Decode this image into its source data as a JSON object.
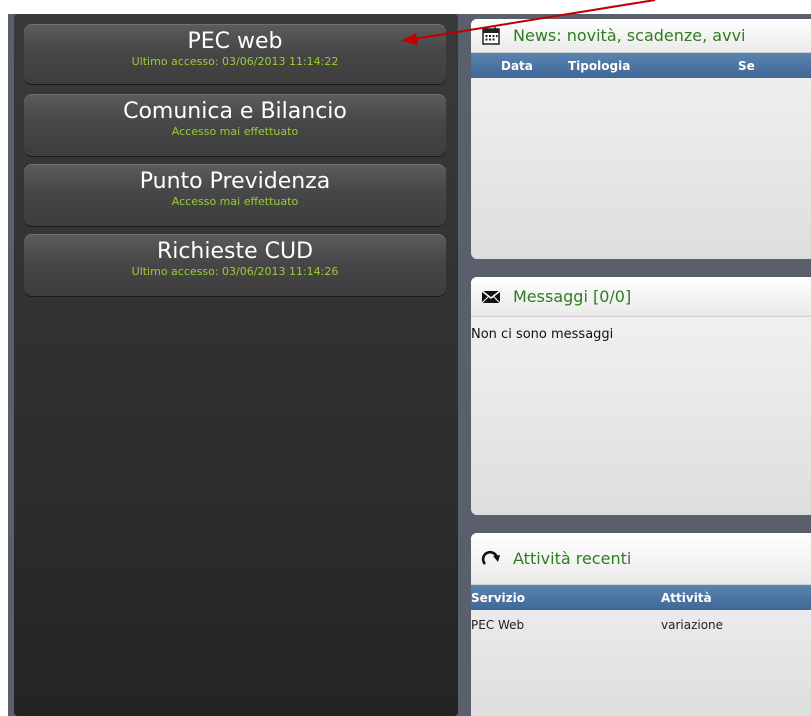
{
  "services": [
    {
      "name": "PEC web",
      "access": "Ultimo accesso: 03/06/2013 11:14:22"
    },
    {
      "name": "Comunica e Bilancio",
      "access": "Accesso mai effettuato"
    },
    {
      "name": "Punto Previdenza",
      "access": "Accesso mai effettuato"
    },
    {
      "name": "Richieste CUD",
      "access": "Ultimo accesso: 03/06/2013 11:14:26"
    }
  ],
  "news": {
    "title": "News: novità, scadenze, avvi",
    "icon": "calendar-icon",
    "columns": [
      "Data",
      "Tipologia",
      "Se"
    ]
  },
  "messages": {
    "title": "Messaggi [0/0]",
    "icon": "envelope-icon",
    "empty_text": "Non ci sono messaggi"
  },
  "recent": {
    "title": "Attività recenti",
    "icon": "refresh-icon",
    "columns": [
      "Servizio",
      "Attività"
    ],
    "rows": [
      [
        "PEC Web",
        "variazione"
      ]
    ]
  },
  "colors": {
    "access_text": "#9acd32",
    "card_title": "#2e7d1f",
    "table_header": "#4a72a0",
    "annotation_arrow": "#c00000"
  }
}
